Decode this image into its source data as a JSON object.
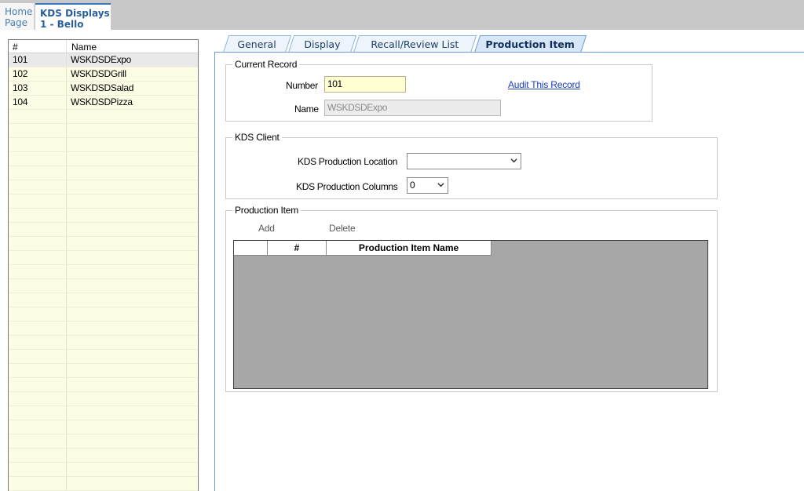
{
  "top_tabs": {
    "home": {
      "line1": "Home",
      "line2": "Page"
    },
    "kds": {
      "line1": "KDS Displays",
      "line2": "1 - Bello"
    }
  },
  "list": {
    "headers": {
      "num": "#",
      "name": "Name"
    },
    "rows": [
      {
        "num": "101",
        "name": "WSKDSDExpo"
      },
      {
        "num": "102",
        "name": "WSKDSDGrill"
      },
      {
        "num": "103",
        "name": "WSKDSDSalad"
      },
      {
        "num": "104",
        "name": "WSKDSDPizza"
      }
    ]
  },
  "tabs": {
    "general": "General",
    "display": "Display",
    "recall": "Recall/Review List",
    "production": "Production Item"
  },
  "current_record": {
    "title": "Current Record",
    "number_label": "Number",
    "number_value": "101",
    "name_label": "Name",
    "name_value": "WSKDSDExpo",
    "audit_link": "Audit This Record"
  },
  "kds_client": {
    "title": "KDS Client",
    "location_label": "KDS Production Location",
    "location_value": "",
    "columns_label": "KDS Production Columns",
    "columns_value": "0"
  },
  "production_item": {
    "title": "Production Item",
    "add_label": "Add",
    "delete_label": "Delete",
    "grid_headers": {
      "num": "#",
      "name": "Production Item Name"
    }
  },
  "icons": {
    "dropdown": "chevron-down-icon"
  }
}
